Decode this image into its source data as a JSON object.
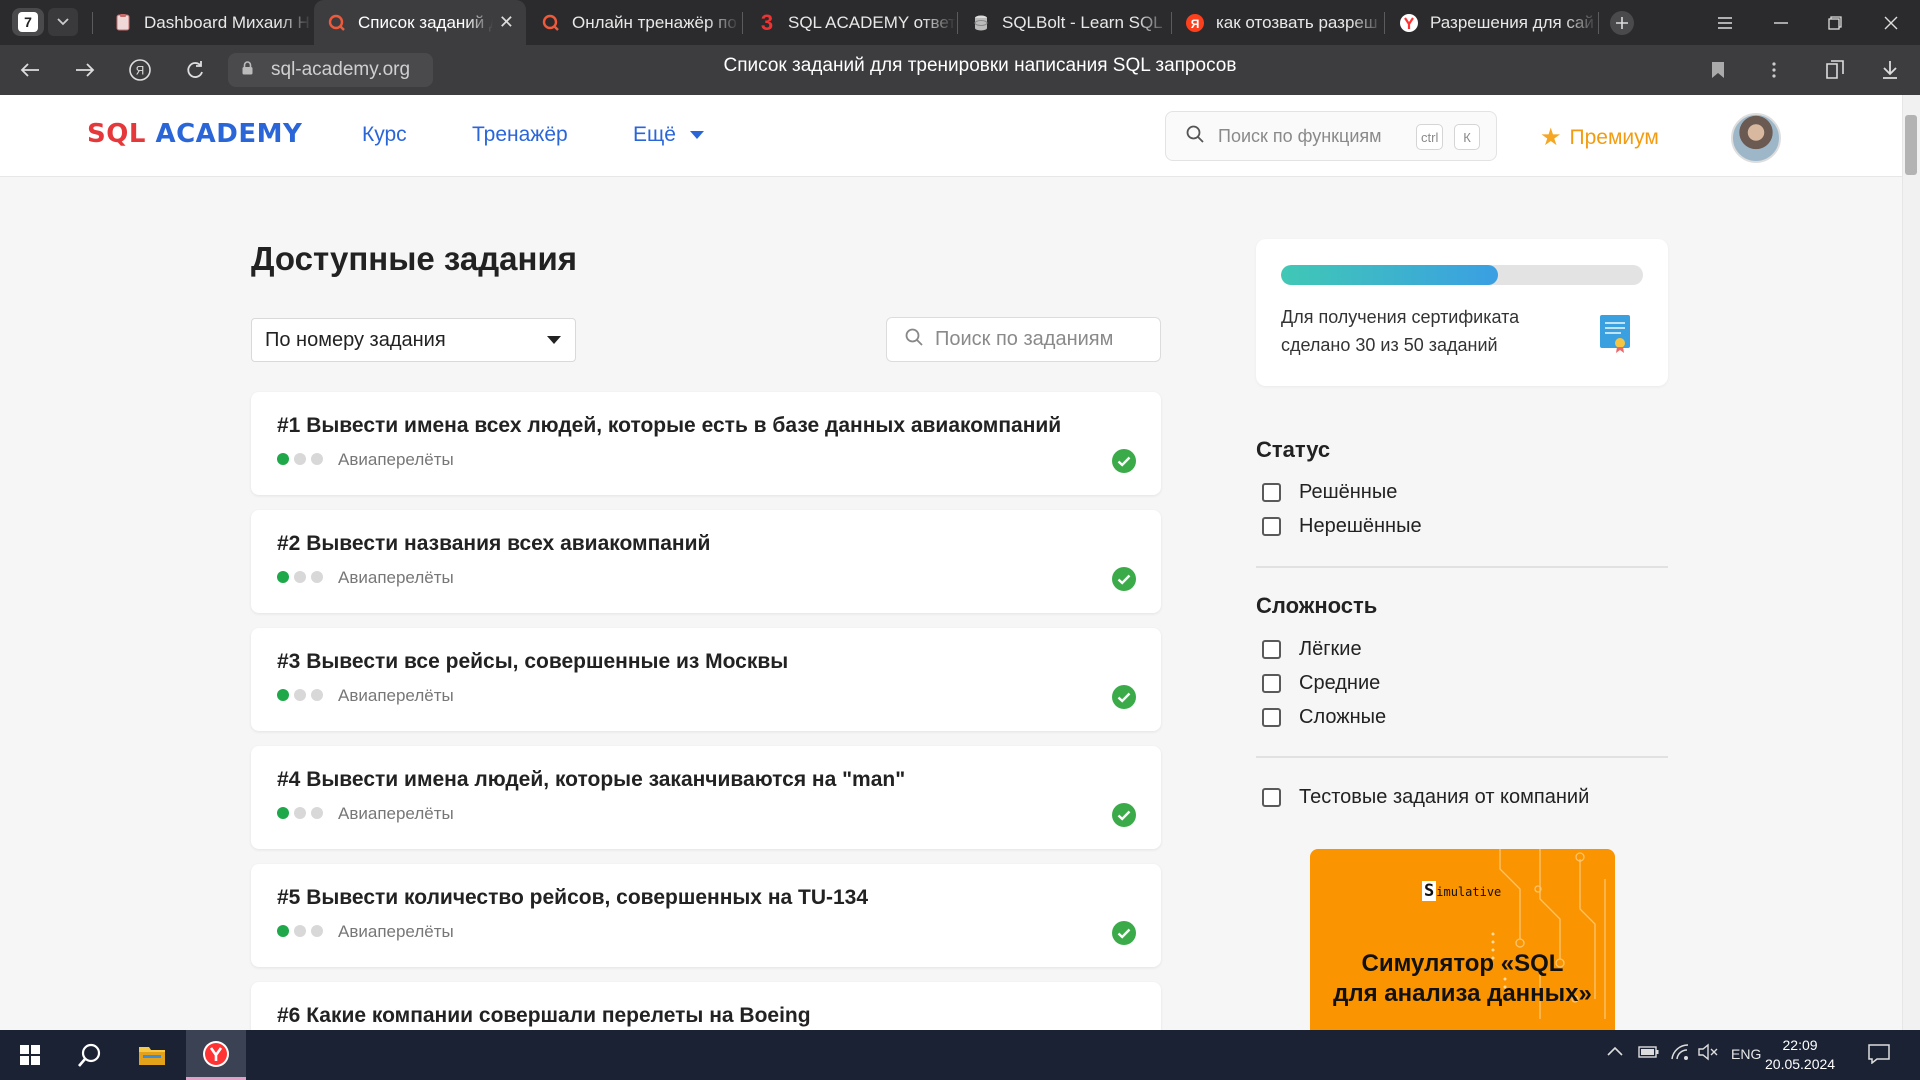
{
  "browser": {
    "tab_count": "7",
    "tabs": [
      {
        "label": "Dashboard Михаил Н",
        "icon": "doc-icon"
      },
      {
        "label": "Список заданий дл",
        "icon": "search-q-icon"
      },
      {
        "label": "Онлайн тренажёр по",
        "icon": "search-q-icon"
      },
      {
        "label": "SQL ACADEMY ответ",
        "icon": "brand-3-icon"
      },
      {
        "label": "SQLBolt - Learn SQL",
        "icon": "database-icon"
      },
      {
        "label": "как отозвать разреш",
        "icon": "yandex-icon"
      },
      {
        "label": "Разрешения для сай",
        "icon": "yandex-browser-icon"
      }
    ],
    "url": "sql-academy.org",
    "page_title": "Список заданий для тренировки написания SQL запросов"
  },
  "header": {
    "logo_part1": "SQL",
    "logo_part2": "ACADEMY",
    "nav": [
      "Курс",
      "Тренажёр",
      "Ещё"
    ],
    "search_placeholder": "Поиск по функциям",
    "kbd_ctrl": "ctrl",
    "kbd_key": "К",
    "premium_label": "Премиум"
  },
  "main": {
    "heading": "Доступные задания",
    "sort_value": "По номеру задания",
    "search_placeholder": "Поиск по заданиям",
    "tasks": [
      {
        "title": "#1 Вывести имена всех людей, которые есть в базе данных авиакомпаний",
        "category": "Авиаперелёты",
        "difficulty": 1,
        "solved": true
      },
      {
        "title": "#2 Вывести названия всех авиакомпаний",
        "category": "Авиаперелёты",
        "difficulty": 1,
        "solved": true
      },
      {
        "title": "#3 Вывести все рейсы, совершенные из Москвы",
        "category": "Авиаперелёты",
        "difficulty": 1,
        "solved": true
      },
      {
        "title": "#4 Вывести имена людей, которые заканчиваются на \"man\"",
        "category": "Авиаперелёты",
        "difficulty": 1,
        "solved": true
      },
      {
        "title": "#5 Вывести количество рейсов, совершенных на TU-134",
        "category": "Авиаперелёты",
        "difficulty": 1,
        "solved": true
      },
      {
        "title": "#6 Какие компании совершали перелеты на Boeing",
        "category": "",
        "difficulty": 1,
        "solved": true
      }
    ]
  },
  "sidebar": {
    "progress": {
      "fraction": 0.6,
      "text_line1": "Для получения сертификата",
      "text_line2": "сделано 30 из 50 заданий"
    },
    "status": {
      "heading": "Статус",
      "options": [
        "Решённые",
        "Нерешённые"
      ]
    },
    "complexity": {
      "heading": "Сложность",
      "options": [
        "Лёгкие",
        "Средние",
        "Сложные"
      ]
    },
    "company_tests": "Тестовые задания от компаний",
    "promo": {
      "brand_first": "S",
      "brand_rest": "imulative",
      "title_line1": "Симулятор «SQL",
      "title_line2": "для анализа данных»"
    }
  },
  "taskbar": {
    "lang": "ENG",
    "time": "22:09",
    "date": "20.05.2024"
  },
  "colors": {
    "accent_blue": "#2b66d9",
    "logo_red": "#e5383b",
    "success_green": "#3bab4a",
    "premium_orange": "#f39c12",
    "promo_orange": "#fa9400"
  }
}
